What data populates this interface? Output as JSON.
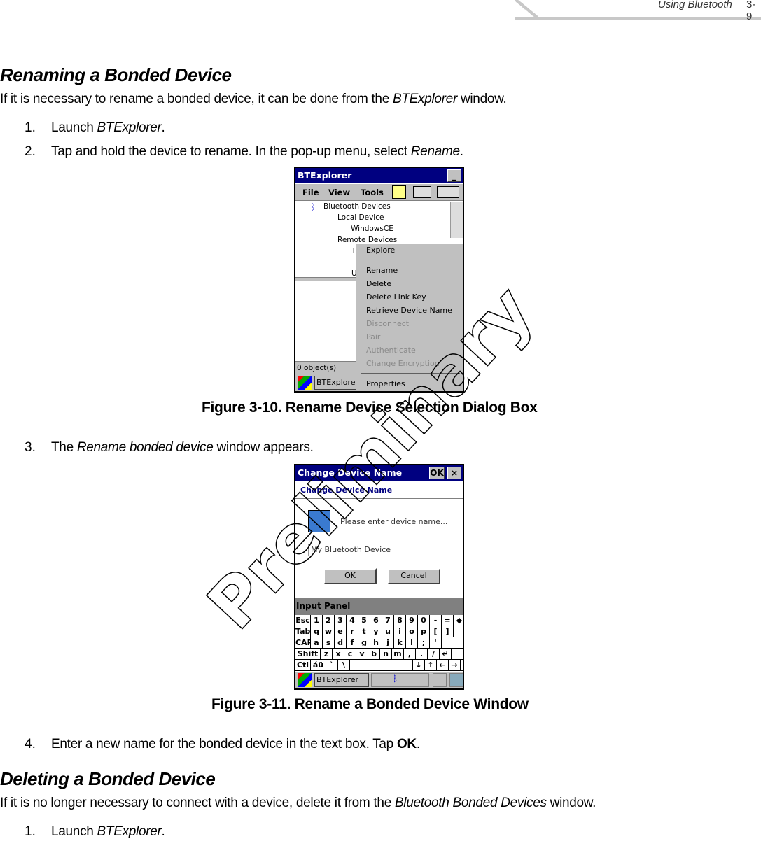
{
  "header": {
    "section": "Using Bluetooth",
    "page": "3-9"
  },
  "section1": {
    "heading": "Renaming a Bonded Device",
    "intro_pre": "If it is necessary to rename a bonded device, it can be done from the ",
    "intro_em": "BTExplorer",
    "intro_post": " window.",
    "steps": [
      {
        "num": "1.",
        "pre": "Launch ",
        "em": "BTExplorer",
        "post": "."
      },
      {
        "num": "2.",
        "pre": "Tap and hold the device to rename. In the pop-up menu, select ",
        "em": "Rename",
        "post": "."
      },
      {
        "num": "3.",
        "pre": "The ",
        "em": "Rename bonded device",
        "post": " window appears."
      },
      {
        "num": "4.",
        "pre": "Enter a new name for the bonded device in the text box. Tap ",
        "strong": "OK",
        "post": "."
      }
    ]
  },
  "figure1": {
    "caption": "Figure 3-10.  Rename Device Selection Dialog Box",
    "window_title": "BTExplorer",
    "menus": [
      "File",
      "View",
      "Tools"
    ],
    "tree": [
      "Bluetooth Devices",
      "Local Device",
      "WindowsCE",
      "Remote Devices",
      "T",
      "U"
    ],
    "status": "0 object(s)",
    "taskbar_app": "BTExplore",
    "context_menu": [
      {
        "label": "Explore",
        "enabled": true
      },
      {
        "label": "Rename",
        "enabled": true
      },
      {
        "label": "Delete",
        "enabled": true
      },
      {
        "label": "Delete Link Key",
        "enabled": true
      },
      {
        "label": "Retrieve Device Name",
        "enabled": true
      },
      {
        "label": "Disconnect",
        "enabled": false
      },
      {
        "label": "Pair",
        "enabled": false
      },
      {
        "label": "Authenticate",
        "enabled": false
      },
      {
        "label": "Change Encryption",
        "enabled": false
      },
      {
        "label": "Properties",
        "enabled": true
      }
    ]
  },
  "figure2": {
    "caption": "Figure 3-11.  Rename a Bonded Device Window",
    "window_title": "Change Device Name",
    "ok_title": "OK",
    "close": "×",
    "subtitle": "Change Device Name",
    "prompt": "Please enter device name...",
    "input_value": "My Bluetooth Device",
    "ok": "OK",
    "cancel": "Cancel",
    "input_panel": "Input Panel",
    "taskbar_app": "BTExplorer",
    "keyboard": [
      [
        "Esc",
        "1",
        "2",
        "3",
        "4",
        "5",
        "6",
        "7",
        "8",
        "9",
        "0",
        "-",
        "=",
        "◆"
      ],
      [
        "Tab",
        "q",
        "w",
        "e",
        "r",
        "t",
        "y",
        "u",
        "i",
        "o",
        "p",
        "[",
        "]"
      ],
      [
        "CAP",
        "a",
        "s",
        "d",
        "f",
        "g",
        "h",
        "j",
        "k",
        "l",
        ";",
        "'"
      ],
      [
        "Shift",
        "z",
        "x",
        "c",
        "v",
        "b",
        "n",
        "m",
        ",",
        ".",
        "/",
        "↵"
      ],
      [
        "Ctl",
        "áü",
        "`",
        "\\",
        "",
        "↓",
        "↑",
        "←",
        "→"
      ]
    ]
  },
  "section2": {
    "heading": "Deleting a Bonded Device",
    "intro_pre": "If it is no longer necessary to connect with a device, delete it from the ",
    "intro_em": "Bluetooth Bonded Devices",
    "intro_post": " window.",
    "steps": [
      {
        "num": "1.",
        "pre": "Launch ",
        "em": "BTExplorer",
        "post": "."
      }
    ]
  },
  "watermark": "Preliminary",
  "colors": {
    "titlebar": "#000080",
    "chrome": "#c0c0c0"
  }
}
